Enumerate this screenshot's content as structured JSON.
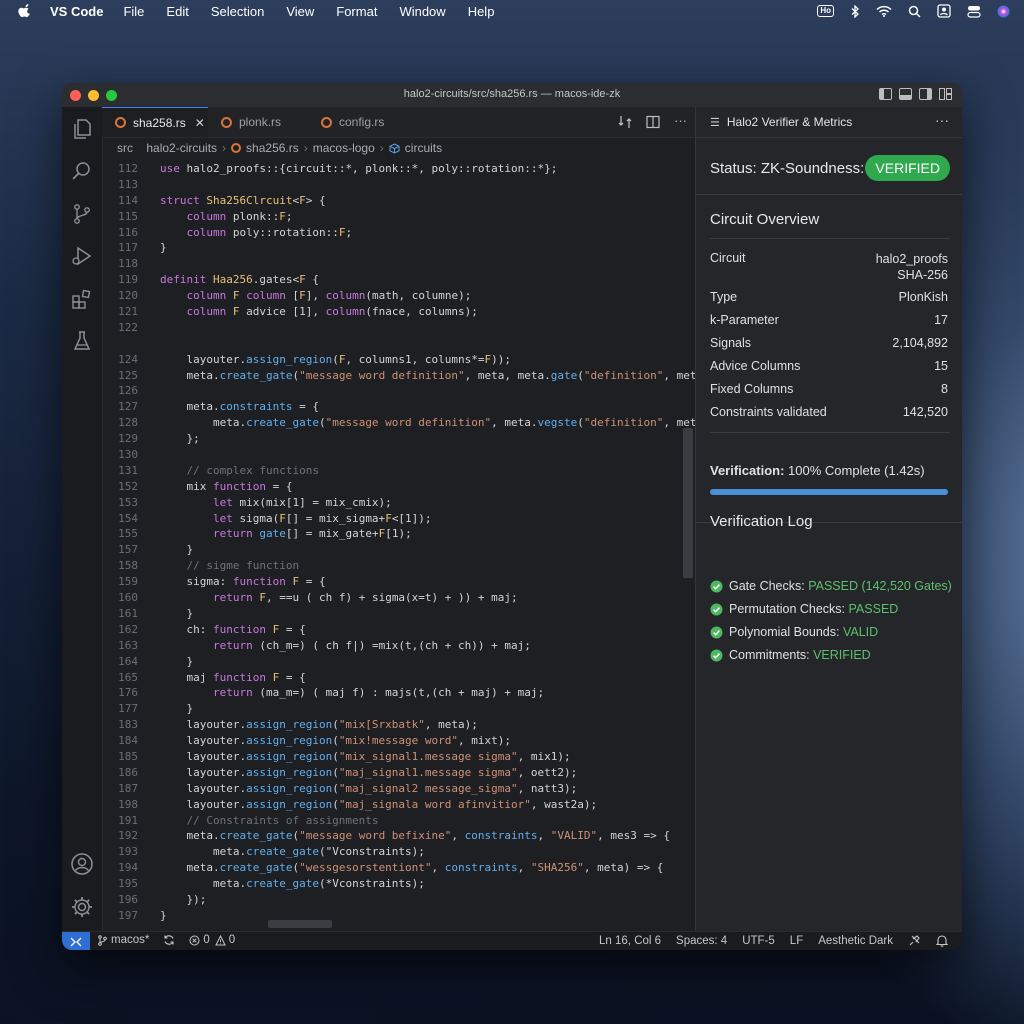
{
  "menubar": {
    "app": "VS Code",
    "items": [
      "File",
      "Edit",
      "Selection",
      "View",
      "Format",
      "Window",
      "Help"
    ],
    "badge": "Ho"
  },
  "window": {
    "title": "halo2-circuits/src/sha256.rs — macos-ide-zk"
  },
  "tabs": [
    {
      "label": "sha258.rs",
      "active": true
    },
    {
      "label": "plonk.rs",
      "active": false
    },
    {
      "label": "config.rs",
      "active": false
    }
  ],
  "breadcrumb": [
    "src",
    "halo2-circuits",
    "sha256.rs",
    "macos-logo",
    "circuits"
  ],
  "code": {
    "lines": [
      {
        "n": "112",
        "t": "use halo2_proofs::{circuit::*, plonk::*, poly::rotation::*};"
      },
      {
        "n": "113",
        "t": ""
      },
      {
        "n": "114",
        "t": "struct Sha256Clrcuit<F> {"
      },
      {
        "n": "115",
        "t": "    column plonk::F;"
      },
      {
        "n": "116",
        "t": "    column poly::rotation::F;"
      },
      {
        "n": "117",
        "t": "}"
      },
      {
        "n": "118",
        "t": ""
      },
      {
        "n": "119",
        "t": "definit Haa256.gates<F {"
      },
      {
        "n": "120",
        "t": "    column F column [F], column(math, columne);"
      },
      {
        "n": "121",
        "t": "    column F advice [1], column(fnace, columns);"
      },
      {
        "n": "122",
        "t": ""
      },
      {
        "n": "",
        "t": ""
      },
      {
        "n": "124",
        "t": "    layouter.assign_region(F, columns1, columns*=F));"
      },
      {
        "n": "125",
        "t": "    meta.create_gate(\"message word definition\", meta, meta.gate(\"definition\", meta"
      },
      {
        "n": "126",
        "t": ""
      },
      {
        "n": "127",
        "t": "    meta.constraints = {"
      },
      {
        "n": "128",
        "t": "        meta.create_gate(\"message word definition\", meta.vegste(\"definition\", meta"
      },
      {
        "n": "129",
        "t": "    };"
      },
      {
        "n": "130",
        "t": ""
      },
      {
        "n": "131",
        "t": "    // complex functions"
      },
      {
        "n": "152",
        "t": "    mix function = {"
      },
      {
        "n": "153",
        "t": "        let mix(mix[1] = mix_cmix);"
      },
      {
        "n": "154",
        "t": "        let sigma(F[] = mix_sigma+F<[1]);"
      },
      {
        "n": "155",
        "t": "        return gate[] = mix_gate+F[1);"
      },
      {
        "n": "157",
        "t": "    }"
      },
      {
        "n": "158",
        "t": "    // sigme function"
      },
      {
        "n": "159",
        "t": "    sigma: function F = {"
      },
      {
        "n": "160",
        "t": "        return F, ==u ( ch f) + sigma(x=t) + )) + maj;"
      },
      {
        "n": "161",
        "t": "    }"
      },
      {
        "n": "162",
        "t": "    ch: function F = {"
      },
      {
        "n": "163",
        "t": "        return (ch_m=) ( ch f|) =mix(t,(ch + ch)) + maj;"
      },
      {
        "n": "164",
        "t": "    }"
      },
      {
        "n": "165",
        "t": "    maj function F = {"
      },
      {
        "n": "176",
        "t": "        return (ma_m=) ( maj f) : majs(t,(ch + maj) + maj;"
      },
      {
        "n": "177",
        "t": "    }"
      },
      {
        "n": "183",
        "t": "    layouter.assign_region(\"mix[Srxbatk\", meta);"
      },
      {
        "n": "184",
        "t": "    layouter.assign_region(\"mix!message word\", mixt);"
      },
      {
        "n": "185",
        "t": "    layouter.assign_region(\"mix_signal1.message sigma\", mix1);"
      },
      {
        "n": "186",
        "t": "    layouter.assign_region(\"maj_signal1.message sigma\", oett2);"
      },
      {
        "n": "187",
        "t": "    layouter.assign_region(\"maj_signal2 message_sigma\", natt3);"
      },
      {
        "n": "198",
        "t": "    layouter.assign_region(\"maj_signala word afinvitior\", wast2a);"
      },
      {
        "n": "191",
        "t": "    // Constraints of assignments"
      },
      {
        "n": "192",
        "t": "    meta.create_gate(\"message word befixine\", constraints, \"VALID\", mes3 => {"
      },
      {
        "n": "193",
        "t": "        meta.create_gate(\"Vconstraints);"
      },
      {
        "n": "194",
        "t": "    meta.create_gate(\"wessgesorstentiont\", constraints, \"SHA256\", meta) => {"
      },
      {
        "n": "195",
        "t": "        meta.create_gate(*Vconstraints);"
      },
      {
        "n": "196",
        "t": "    });"
      },
      {
        "n": "197",
        "t": "}"
      }
    ]
  },
  "panel": {
    "tab_label": "Halo2 Verifier & Metrics",
    "status_label": "Status: ZK-Soundness:",
    "status_value": "VERIFIED",
    "overview_title": "Circuit Overview",
    "overview": [
      {
        "k": "Circuit",
        "v": "halo2_proofs\nSHA-256"
      },
      {
        "k": "Type",
        "v": "PlonKish"
      },
      {
        "k": "k-Parameter",
        "v": "17"
      },
      {
        "k": "Signals",
        "v": "2,104,892"
      },
      {
        "k": "Advice Columns",
        "v": "15"
      },
      {
        "k": "Fixed Columns",
        "v": "8"
      },
      {
        "k": "Constraints validated",
        "v": "142,520"
      }
    ],
    "verification_label": "Verification:",
    "verification_value": "100% Complete (1.42s)",
    "progress": 1.0,
    "log_title": "Verification Log",
    "log": [
      {
        "label": "Gate Checks:",
        "status": "PASSED (142,520 Gates)"
      },
      {
        "label": "Permutation Checks:",
        "status": "PASSED"
      },
      {
        "label": "Polynomial Bounds:",
        "status": "VALID"
      },
      {
        "label": "Commitments:",
        "status": "VERIFIED"
      }
    ]
  },
  "statusbar": {
    "branch": "macos*",
    "problems": "0",
    "warnings": "0",
    "position": "Ln 16, Col 6",
    "spaces": "Spaces: 4",
    "encoding": "UTF-5",
    "eol": "LF",
    "theme": "Aesthetic Dark"
  },
  "colors": {
    "accent": "#3b82f6",
    "verified_pill": "#2fa94d",
    "ok_text": "#5cc16e",
    "progress": "#4a90d9",
    "remote": "#2f6fd4"
  }
}
